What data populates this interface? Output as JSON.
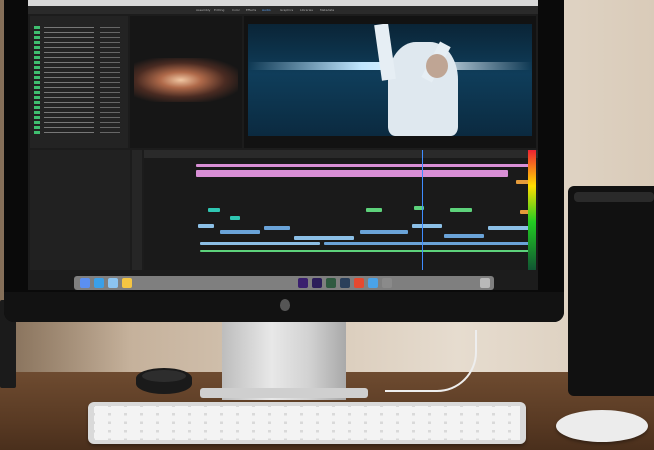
{
  "scene": {
    "description_kind": "photo of a desktop monitor running a video editor",
    "colors": {
      "wall": "#d7c8b6",
      "desk": "#5a3b24",
      "monitor": "#0a0a0a",
      "accent": "#3f8cff"
    }
  },
  "editor": {
    "workspace_tabs": [
      "Assembly",
      "Editing",
      "Color",
      "Effects",
      "Audio",
      "Graphics",
      "Libraries",
      "Metadata"
    ],
    "active_workspace_index": 4,
    "panels": [
      "project-panel",
      "source-monitor",
      "program-monitor",
      "timeline-panel",
      "audio-meter"
    ]
  },
  "icons": {
    "apple": "apple-logo-icon",
    "dock": [
      "finder-icon",
      "safari-icon",
      "mail-icon",
      "photos-icon",
      "premiere-icon",
      "after-effects-icon",
      "speedgrade-icon",
      "lightroom-icon",
      "music-icon",
      "app-store-icon",
      "settings-icon",
      "trash-icon"
    ]
  }
}
